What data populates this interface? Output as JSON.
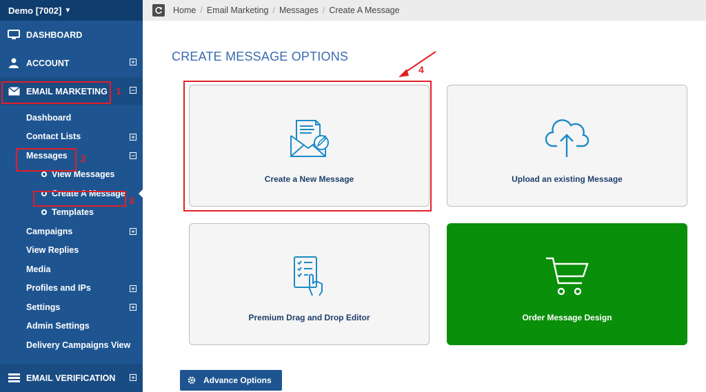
{
  "sidebar": {
    "account": "Demo [7002]",
    "main": {
      "dashboard": "DASHBOARD",
      "account": "ACCOUNT",
      "email_marketing": "EMAIL MARKETING",
      "email_verification": "EMAIL VERIFICATION"
    },
    "sub": {
      "dashboard": "Dashboard",
      "contact_lists": "Contact Lists",
      "messages": "Messages",
      "view_messages": "View Messages",
      "create_message": "Create A Message",
      "templates": "Templates",
      "campaigns": "Campaigns",
      "view_replies": "View Replies",
      "media": "Media",
      "profiles_ips": "Profiles and IPs",
      "settings": "Settings",
      "admin_settings": "Admin Settings",
      "delivery_campaigns_view": "Delivery Campaigns View"
    },
    "plus": "⊞",
    "minus": "⊟"
  },
  "breadcrumb": {
    "items": [
      "Home",
      "Email Marketing",
      "Messages",
      "Create A Message"
    ],
    "sep": "/"
  },
  "page": {
    "title": "CREATE MESSAGE OPTIONS",
    "cards": {
      "create_new": "Create a New Message",
      "upload_existing": "Upload an existing Message",
      "drag_drop": "Premium Drag and Drop Editor",
      "order_design": "Order Message Design"
    },
    "advance_options": "Advance Options"
  },
  "annotations": {
    "n1": "1",
    "n2": "2",
    "n3": "3",
    "n4": "4"
  },
  "colors": {
    "sidebar": "#1e5591",
    "accent_red": "#e41e26",
    "green_card": "#0a8f0a",
    "title_blue": "#3a6ab0"
  }
}
